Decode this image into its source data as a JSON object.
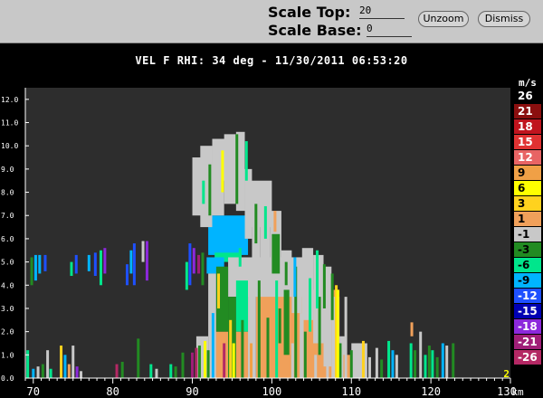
{
  "toolbar": {
    "scale_top_label": "Scale Top:",
    "scale_top_value": "20",
    "scale_base_label": "Scale Base:",
    "scale_base_value": "0",
    "unzoom_label": "Unzoom",
    "dismiss_label": "Dismiss"
  },
  "plot": {
    "title": "VEL F  RHI: 34 deg  -  11/30/2011 06:53:20",
    "corner_label": "2"
  },
  "chart_data": {
    "type": "heatmap",
    "title": "VEL F  RHI: 34 deg  -  11/30/2011 06:53:20",
    "xlabel": "",
    "ylabel": "",
    "x_unit": "km",
    "x_ticks": [
      "70",
      "80",
      "90",
      "100",
      "110",
      "120",
      "130"
    ],
    "x_range": [
      69,
      130
    ],
    "y_ticks": [
      "0.0",
      "1.0",
      "2.0",
      "3.0",
      "4.0",
      "5.0",
      "6.0",
      "7.0",
      "8.0",
      "9.0",
      "10.0",
      "11.0",
      "12.0"
    ],
    "y_range": [
      0,
      12.5
    ],
    "colorbar": {
      "unit": "m/s",
      "labels": [
        "26",
        "21",
        "18",
        "15",
        "12",
        "9",
        "6",
        "3",
        "1",
        "-1",
        "-3",
        "-6",
        "-9",
        "-12",
        "-15",
        "-18",
        "-21",
        "-26"
      ],
      "colors": [
        "#000000",
        "#8b0f0f",
        "#c0141e",
        "#e03232",
        "#e86464",
        "#f0a046",
        "#ffff00",
        "#ffd21e",
        "#f0a05a",
        "#c8c8c8",
        "#228b22",
        "#00e68c",
        "#00b4ff",
        "#1e50ff",
        "#0000b4",
        "#8c28dc",
        "#a01e78",
        "#b42864"
      ],
      "text_colors": [
        "#ffffff",
        "#ffffff",
        "#ffffff",
        "#ffffff",
        "#ffffff",
        "#000000",
        "#000000",
        "#000000",
        "#000000",
        "#000000",
        "#000000",
        "#000000",
        "#000000",
        "#ffffff",
        "#ffffff",
        "#ffffff",
        "#ffffff",
        "#ffffff"
      ]
    },
    "regions": [
      {
        "x0": 92.0,
        "x1": 97.0,
        "y0": 5.3,
        "y1": 7.0,
        "c": "-9"
      },
      {
        "x0": 92.8,
        "x1": 96.2,
        "y0": 5.0,
        "y1": 5.4,
        "c": "-6"
      },
      {
        "x0": 91.8,
        "x1": 94.0,
        "y0": 4.5,
        "y1": 5.2,
        "c": "-9"
      },
      {
        "x0": 98.0,
        "x1": 108.5,
        "y0": 0.0,
        "y1": 3.8,
        "c": "1"
      },
      {
        "x0": 93.0,
        "x1": 97.5,
        "y0": 0.0,
        "y1": 2.0,
        "c": "1"
      },
      {
        "x0": 94.5,
        "x1": 104.0,
        "y0": 3.5,
        "y1": 5.2,
        "c": "-1"
      },
      {
        "x0": 97.0,
        "x1": 100.0,
        "y0": 6.5,
        "y1": 8.5,
        "c": "-1"
      },
      {
        "x0": 93.0,
        "x1": 96.0,
        "y0": 8.5,
        "y1": 10.3,
        "c": "-1"
      }
    ],
    "columns": [
      {
        "x0": 90.0,
        "x1": 91.2,
        "y0": 7.0,
        "y1": 9.5,
        "c": "-1"
      },
      {
        "x0": 91.0,
        "x1": 92.5,
        "y0": 6.5,
        "y1": 10.0,
        "c": "-1"
      },
      {
        "x0": 92.5,
        "x1": 94.0,
        "y0": 7.0,
        "y1": 10.3,
        "c": "-1"
      },
      {
        "x0": 94.0,
        "x1": 95.5,
        "y0": 7.5,
        "y1": 10.5,
        "c": "-1"
      },
      {
        "x0": 95.5,
        "x1": 96.6,
        "y0": 7.2,
        "y1": 10.6,
        "c": "-1"
      },
      {
        "x0": 96.6,
        "x1": 97.5,
        "y0": 6.0,
        "y1": 9.0,
        "c": "-1"
      },
      {
        "x0": 97.5,
        "x1": 98.5,
        "y0": 4.8,
        "y1": 8.3,
        "c": "-1"
      },
      {
        "x0": 98.5,
        "x1": 99.8,
        "y0": 4.5,
        "y1": 7.8,
        "c": "-1"
      },
      {
        "x0": 99.8,
        "x1": 101.2,
        "y0": 3.6,
        "y1": 7.2,
        "c": "-1"
      },
      {
        "x0": 101.2,
        "x1": 102.5,
        "y0": 3.8,
        "y1": 5.5,
        "c": "-1"
      },
      {
        "x0": 102.5,
        "x1": 103.8,
        "y0": 2.8,
        "y1": 5.2,
        "c": "-1"
      },
      {
        "x0": 103.8,
        "x1": 105.2,
        "y0": 2.5,
        "y1": 5.6,
        "c": "-1"
      },
      {
        "x0": 105.2,
        "x1": 106.5,
        "y0": 1.5,
        "y1": 5.3,
        "c": "-1"
      },
      {
        "x0": 106.5,
        "x1": 107.5,
        "y0": 0.5,
        "y1": 4.8,
        "c": "-1"
      },
      {
        "x0": 107.5,
        "x1": 108.5,
        "y0": 0.0,
        "y1": 3.5,
        "c": "-1"
      },
      {
        "x0": 108.5,
        "x1": 109.2,
        "y0": 0.0,
        "y1": 1.8,
        "c": "-1"
      },
      {
        "x0": 92.0,
        "x1": 93.0,
        "y0": 0.0,
        "y1": 4.5,
        "c": "-1"
      },
      {
        "x0": 93.0,
        "x1": 94.5,
        "y0": 2.0,
        "y1": 4.8,
        "c": "-3"
      },
      {
        "x0": 94.5,
        "x1": 95.5,
        "y0": 0.0,
        "y1": 3.5,
        "c": "-3"
      },
      {
        "x0": 95.5,
        "x1": 97.0,
        "y0": 2.0,
        "y1": 4.2,
        "c": "-6"
      },
      {
        "x0": 97.0,
        "x1": 98.0,
        "y0": 0.0,
        "y1": 4.5,
        "c": "-1"
      },
      {
        "x0": 100.0,
        "x1": 101.0,
        "y0": 4.5,
        "y1": 6.2,
        "c": "-3"
      },
      {
        "x0": 101.5,
        "x1": 102.2,
        "y0": 1.0,
        "y1": 3.8,
        "c": "-3"
      },
      {
        "x0": 103.5,
        "x1": 104.0,
        "y0": 0.0,
        "y1": 2.8,
        "c": "-1"
      },
      {
        "x0": 90.5,
        "x1": 92.0,
        "y0": 0.0,
        "y1": 1.8,
        "c": "-1"
      },
      {
        "x0": 109.0,
        "x1": 110.0,
        "y0": 0.0,
        "y1": 1.0,
        "c": "1"
      },
      {
        "x0": 110.0,
        "x1": 112.0,
        "y0": 0.0,
        "y1": 1.5,
        "c": "-1"
      }
    ],
    "streaks": [
      {
        "x": 69.3,
        "y0": 0.0,
        "y1": 1.2,
        "c": "-6"
      },
      {
        "x": 70.0,
        "y0": 0.0,
        "y1": 0.4,
        "c": "-9"
      },
      {
        "x": 70.6,
        "y0": 0.0,
        "y1": 0.5,
        "c": "-1"
      },
      {
        "x": 69.8,
        "y0": 4.0,
        "y1": 5.2,
        "c": "-3"
      },
      {
        "x": 70.3,
        "y0": 4.2,
        "y1": 5.3,
        "c": "-9"
      },
      {
        "x": 70.8,
        "y0": 4.5,
        "y1": 5.3,
        "c": "-9"
      },
      {
        "x": 71.5,
        "y0": 4.6,
        "y1": 5.3,
        "c": "-12"
      },
      {
        "x": 71.2,
        "y0": 0.0,
        "y1": 0.6,
        "c": "-3"
      },
      {
        "x": 71.8,
        "y0": 0.0,
        "y1": 1.2,
        "c": "-1"
      },
      {
        "x": 72.2,
        "y0": 0.0,
        "y1": 0.4,
        "c": "-6"
      },
      {
        "x": 73.5,
        "y0": 0.0,
        "y1": 1.4,
        "c": "3"
      },
      {
        "x": 74.0,
        "y0": 0.0,
        "y1": 1.0,
        "c": "-9"
      },
      {
        "x": 74.5,
        "y0": 0.0,
        "y1": 0.6,
        "c": "1"
      },
      {
        "x": 75.0,
        "y0": 0.0,
        "y1": 1.4,
        "c": "-1"
      },
      {
        "x": 75.5,
        "y0": 0.0,
        "y1": 0.5,
        "c": "-18"
      },
      {
        "x": 76.0,
        "y0": 0.0,
        "y1": 0.3,
        "c": "-1"
      },
      {
        "x": 74.8,
        "y0": 4.4,
        "y1": 5.0,
        "c": "-6"
      },
      {
        "x": 75.4,
        "y0": 4.5,
        "y1": 5.3,
        "c": "-12"
      },
      {
        "x": 77.0,
        "y0": 4.6,
        "y1": 5.3,
        "c": "-9"
      },
      {
        "x": 77.8,
        "y0": 4.4,
        "y1": 5.4,
        "c": "-12"
      },
      {
        "x": 78.5,
        "y0": 4.0,
        "y1": 5.5,
        "c": "-6"
      },
      {
        "x": 79.0,
        "y0": 4.5,
        "y1": 5.6,
        "c": "-18"
      },
      {
        "x": 80.5,
        "y0": 0.0,
        "y1": 0.6,
        "c": "-26"
      },
      {
        "x": 81.2,
        "y0": 0.0,
        "y1": 0.7,
        "c": "-3"
      },
      {
        "x": 81.8,
        "y0": 4.0,
        "y1": 4.9,
        "c": "-12"
      },
      {
        "x": 82.3,
        "y0": 4.5,
        "y1": 5.5,
        "c": "-9"
      },
      {
        "x": 82.7,
        "y0": 4.0,
        "y1": 5.8,
        "c": "-12"
      },
      {
        "x": 83.2,
        "y0": 0.0,
        "y1": 1.7,
        "c": "-3"
      },
      {
        "x": 83.8,
        "y0": 5.0,
        "y1": 5.9,
        "c": "-1"
      },
      {
        "x": 84.3,
        "y0": 4.2,
        "y1": 5.9,
        "c": "-18"
      },
      {
        "x": 84.8,
        "y0": 0.0,
        "y1": 0.6,
        "c": "-6"
      },
      {
        "x": 85.5,
        "y0": 0.0,
        "y1": 0.4,
        "c": "-1"
      },
      {
        "x": 87.3,
        "y0": 0.0,
        "y1": 0.6,
        "c": "-6"
      },
      {
        "x": 87.9,
        "y0": 0.0,
        "y1": 0.5,
        "c": "-3"
      },
      {
        "x": 89.3,
        "y0": 3.8,
        "y1": 5.0,
        "c": "-6"
      },
      {
        "x": 89.7,
        "y0": 4.0,
        "y1": 5.8,
        "c": "-12"
      },
      {
        "x": 90.2,
        "y0": 4.5,
        "y1": 5.6,
        "c": "-18"
      },
      {
        "x": 90.8,
        "y0": 4.5,
        "y1": 5.3,
        "c": "-21"
      },
      {
        "x": 91.3,
        "y0": 4.0,
        "y1": 5.4,
        "c": "-3"
      },
      {
        "x": 90.0,
        "y0": 0.0,
        "y1": 1.1,
        "c": "-21"
      },
      {
        "x": 90.5,
        "y0": 0.0,
        "y1": 1.3,
        "c": "-26"
      },
      {
        "x": 90.9,
        "y0": 0.0,
        "y1": 1.4,
        "c": "-3"
      },
      {
        "x": 91.6,
        "y0": 0.0,
        "y1": 1.6,
        "c": "6"
      },
      {
        "x": 92.0,
        "y0": 0.0,
        "y1": 1.2,
        "c": "-3"
      },
      {
        "x": 92.6,
        "y0": 0.0,
        "y1": 2.8,
        "c": "-9"
      },
      {
        "x": 93.3,
        "y0": 3.0,
        "y1": 4.5,
        "c": "3"
      },
      {
        "x": 94.0,
        "y0": 0.0,
        "y1": 1.5,
        "c": "-26"
      },
      {
        "x": 94.8,
        "y0": 0.0,
        "y1": 2.5,
        "c": "3"
      },
      {
        "x": 95.2,
        "y0": 0.0,
        "y1": 1.5,
        "c": "6"
      },
      {
        "x": 96.3,
        "y0": 0.0,
        "y1": 2.5,
        "c": "-3"
      },
      {
        "x": 97.4,
        "y0": 0.0,
        "y1": 1.5,
        "c": "9"
      },
      {
        "x": 98.4,
        "y0": 0.0,
        "y1": 4.2,
        "c": "-3"
      },
      {
        "x": 99.5,
        "y0": 0.0,
        "y1": 2.6,
        "c": "-3"
      },
      {
        "x": 100.6,
        "y0": 0.0,
        "y1": 4.2,
        "c": "-6"
      },
      {
        "x": 101.0,
        "y0": 1.5,
        "y1": 3.0,
        "c": "-3"
      },
      {
        "x": 102.6,
        "y0": 0.0,
        "y1": 1.5,
        "c": "-1"
      },
      {
        "x": 103.0,
        "y0": 0.0,
        "y1": 4.8,
        "c": "-3"
      },
      {
        "x": 104.2,
        "y0": 0.0,
        "y1": 2.0,
        "c": "-3"
      },
      {
        "x": 104.8,
        "y0": 2.0,
        "y1": 4.3,
        "c": "-6"
      },
      {
        "x": 105.5,
        "y0": 0.0,
        "y1": 1.0,
        "c": "-1"
      },
      {
        "x": 106.0,
        "y0": 1.0,
        "y1": 3.5,
        "c": "-3"
      },
      {
        "x": 106.6,
        "y0": 3.0,
        "y1": 4.9,
        "c": "-3"
      },
      {
        "x": 107.0,
        "y0": 0.0,
        "y1": 2.0,
        "c": "-1"
      },
      {
        "x": 107.6,
        "y0": 2.5,
        "y1": 4.5,
        "c": "-3"
      },
      {
        "x": 108.1,
        "y0": 0.0,
        "y1": 4.0,
        "c": "3"
      },
      {
        "x": 108.6,
        "y0": 0.0,
        "y1": 1.5,
        "c": "-3"
      },
      {
        "x": 109.3,
        "y0": 0.0,
        "y1": 3.5,
        "c": "-1"
      },
      {
        "x": 110.0,
        "y0": 0.0,
        "y1": 1.2,
        "c": "-3"
      },
      {
        "x": 110.8,
        "y0": 0.0,
        "y1": 1.5,
        "c": "-1"
      },
      {
        "x": 111.5,
        "y0": 0.0,
        "y1": 1.6,
        "c": "3"
      },
      {
        "x": 112.3,
        "y0": 0.0,
        "y1": 0.9,
        "c": "-1"
      },
      {
        "x": 113.2,
        "y0": 0.0,
        "y1": 1.3,
        "c": "-1"
      },
      {
        "x": 113.8,
        "y0": 0.0,
        "y1": 0.8,
        "c": "-3"
      },
      {
        "x": 114.7,
        "y0": 0.0,
        "y1": 1.6,
        "c": "-6"
      },
      {
        "x": 115.2,
        "y0": 0.0,
        "y1": 1.2,
        "c": "-9"
      },
      {
        "x": 117.5,
        "y0": 0.0,
        "y1": 1.5,
        "c": "-6"
      },
      {
        "x": 118.0,
        "y0": 0.0,
        "y1": 1.2,
        "c": "-3"
      },
      {
        "x": 118.7,
        "y0": 0.0,
        "y1": 2.0,
        "c": "-1"
      },
      {
        "x": 119.3,
        "y0": 0.0,
        "y1": 1.0,
        "c": "-6"
      },
      {
        "x": 120.2,
        "y0": 0.0,
        "y1": 1.2,
        "c": "-6"
      },
      {
        "x": 120.8,
        "y0": 0.0,
        "y1": 0.9,
        "c": "-3"
      },
      {
        "x": 121.5,
        "y0": 0.0,
        "y1": 1.5,
        "c": "-9"
      },
      {
        "x": 122.0,
        "y0": 0.0,
        "y1": 1.4,
        "c": "-1"
      },
      {
        "x": 122.8,
        "y0": 0.0,
        "y1": 1.5,
        "c": "-3"
      },
      {
        "x": 117.6,
        "y0": 1.8,
        "y1": 2.4,
        "c": "1"
      },
      {
        "x": 93.8,
        "y0": 8.0,
        "y1": 9.8,
        "c": "6"
      },
      {
        "x": 95.6,
        "y0": 7.5,
        "y1": 10.5,
        "c": "-3"
      },
      {
        "x": 96.8,
        "y0": 8.5,
        "y1": 10.2,
        "c": "-6"
      },
      {
        "x": 91.4,
        "y0": 7.5,
        "y1": 8.5,
        "c": "-6"
      },
      {
        "x": 92.2,
        "y0": 7.0,
        "y1": 9.2,
        "c": "-3"
      },
      {
        "x": 98.0,
        "y0": 5.8,
        "y1": 7.5,
        "c": "-3"
      },
      {
        "x": 99.2,
        "y0": 6.0,
        "y1": 7.4,
        "c": "-6"
      },
      {
        "x": 100.4,
        "y0": 6.3,
        "y1": 7.2,
        "c": "1"
      },
      {
        "x": 101.8,
        "y0": 4.0,
        "y1": 5.0,
        "c": "-3"
      },
      {
        "x": 102.9,
        "y0": 3.5,
        "y1": 5.2,
        "c": "-9"
      },
      {
        "x": 105.7,
        "y0": 3.0,
        "y1": 5.5,
        "c": "-6"
      },
      {
        "x": 108.3,
        "y0": 0.0,
        "y1": 3.8,
        "c": "6"
      },
      {
        "x": 88.8,
        "y0": 0.0,
        "y1": 1.1,
        "c": "-3"
      },
      {
        "x": 115.7,
        "y0": 0.0,
        "y1": 1.0,
        "c": "-1"
      },
      {
        "x": 119.8,
        "y0": 0.0,
        "y1": 1.4,
        "c": "-3"
      },
      {
        "x": 94.2,
        "y0": 5.5,
        "y1": 6.5,
        "c": "-9"
      },
      {
        "x": 96.0,
        "y0": 4.8,
        "y1": 5.6,
        "c": "-6"
      }
    ]
  }
}
